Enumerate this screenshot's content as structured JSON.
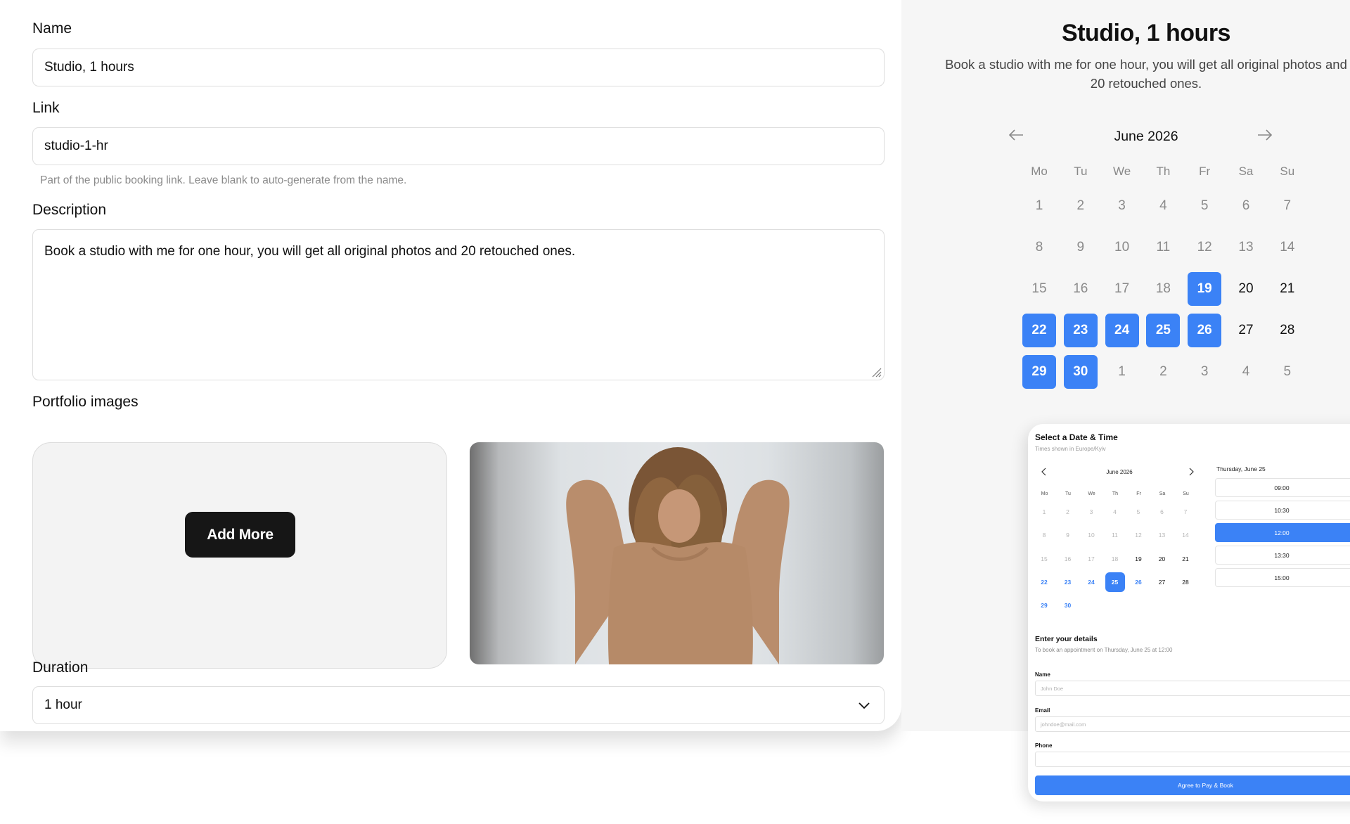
{
  "form": {
    "name_label": "Name",
    "name_value": "Studio, 1 hours",
    "link_label": "Link",
    "link_value": "studio-1-hr",
    "link_hint": "Part of the public booking link. Leave blank to auto-generate from the name.",
    "description_label": "Description",
    "description_value": "Book a studio with me for one hour, you will get all original photos and 20 retouched ones.",
    "portfolio_label": "Portfolio images",
    "add_more_label": "Add More",
    "duration_label": "Duration",
    "duration_value": "1 hour"
  },
  "preview": {
    "title": "Studio, 1 hours",
    "description": "Book a studio with me for one hour, you will get all original photos and 20 retouched ones.",
    "month": "June 2026",
    "weekdays": [
      "Mo",
      "Tu",
      "We",
      "Th",
      "Fr",
      "Sa",
      "Su"
    ],
    "weeks": [
      [
        {
          "d": "1",
          "s": "muted"
        },
        {
          "d": "2",
          "s": "muted"
        },
        {
          "d": "3",
          "s": "muted"
        },
        {
          "d": "4",
          "s": "muted"
        },
        {
          "d": "5",
          "s": "muted"
        },
        {
          "d": "6",
          "s": "muted"
        },
        {
          "d": "7",
          "s": "muted"
        }
      ],
      [
        {
          "d": "8",
          "s": "muted"
        },
        {
          "d": "9",
          "s": "muted"
        },
        {
          "d": "10",
          "s": "muted"
        },
        {
          "d": "11",
          "s": "muted"
        },
        {
          "d": "12",
          "s": "muted"
        },
        {
          "d": "13",
          "s": "muted"
        },
        {
          "d": "14",
          "s": "muted"
        }
      ],
      [
        {
          "d": "15",
          "s": "muted"
        },
        {
          "d": "16",
          "s": "muted"
        },
        {
          "d": "17",
          "s": "muted"
        },
        {
          "d": "18",
          "s": "muted"
        },
        {
          "d": "19",
          "s": "sel"
        },
        {
          "d": "20",
          "s": "avail"
        },
        {
          "d": "21",
          "s": "avail"
        }
      ],
      [
        {
          "d": "22",
          "s": "sel"
        },
        {
          "d": "23",
          "s": "sel"
        },
        {
          "d": "24",
          "s": "sel"
        },
        {
          "d": "25",
          "s": "sel"
        },
        {
          "d": "26",
          "s": "sel"
        },
        {
          "d": "27",
          "s": "avail"
        },
        {
          "d": "28",
          "s": "avail"
        }
      ],
      [
        {
          "d": "29",
          "s": "sel"
        },
        {
          "d": "30",
          "s": "sel"
        },
        {
          "d": "1",
          "s": "muted"
        },
        {
          "d": "2",
          "s": "muted"
        },
        {
          "d": "3",
          "s": "muted"
        },
        {
          "d": "4",
          "s": "muted"
        },
        {
          "d": "5",
          "s": "muted"
        }
      ]
    ]
  },
  "widget": {
    "title": "Select a Date & Time",
    "timezone_note": "Times shown in Europe/Kyiv",
    "month": "June 2026",
    "weekdays": [
      "Mo",
      "Tu",
      "We",
      "Th",
      "Fr",
      "Sa",
      "Su"
    ],
    "weeks": [
      [
        {
          "d": "1",
          "s": "muted"
        },
        {
          "d": "2",
          "s": "muted"
        },
        {
          "d": "3",
          "s": "muted"
        },
        {
          "d": "4",
          "s": "muted"
        },
        {
          "d": "5",
          "s": "muted"
        },
        {
          "d": "6",
          "s": "muted"
        },
        {
          "d": "7",
          "s": "muted"
        }
      ],
      [
        {
          "d": "8",
          "s": "muted"
        },
        {
          "d": "9",
          "s": "muted"
        },
        {
          "d": "10",
          "s": "muted"
        },
        {
          "d": "11",
          "s": "muted"
        },
        {
          "d": "12",
          "s": "muted"
        },
        {
          "d": "13",
          "s": "muted"
        },
        {
          "d": "14",
          "s": "muted"
        }
      ],
      [
        {
          "d": "15",
          "s": "muted"
        },
        {
          "d": "16",
          "s": "muted"
        },
        {
          "d": "17",
          "s": "muted"
        },
        {
          "d": "18",
          "s": "muted"
        },
        {
          "d": "19",
          "s": "avail"
        },
        {
          "d": "20",
          "s": "avail"
        },
        {
          "d": "21",
          "s": "avail"
        }
      ],
      [
        {
          "d": "22",
          "s": "open"
        },
        {
          "d": "23",
          "s": "open"
        },
        {
          "d": "24",
          "s": "open"
        },
        {
          "d": "25",
          "s": "sel"
        },
        {
          "d": "26",
          "s": "open"
        },
        {
          "d": "27",
          "s": "avail"
        },
        {
          "d": "28",
          "s": "avail"
        }
      ],
      [
        {
          "d": "29",
          "s": "open"
        },
        {
          "d": "30",
          "s": "open"
        }
      ]
    ],
    "selected_date_heading": "Thursday, June 25",
    "slots": [
      {
        "time": "09:00",
        "selected": false
      },
      {
        "time": "10:30",
        "selected": false
      },
      {
        "time": "12:00",
        "selected": true
      },
      {
        "time": "13:30",
        "selected": false
      },
      {
        "time": "15:00",
        "selected": false
      }
    ],
    "details_title": "Enter your details",
    "details_note": "To book an appointment on Thursday, June 25 at 12:00",
    "name_label": "Name",
    "name_placeholder": "John Doe",
    "email_label": "Email",
    "email_placeholder": "johndoe@mail.com",
    "phone_label": "Phone",
    "phone_placeholder": "",
    "submit_label": "Agree to Pay & Book"
  },
  "colors": {
    "accent": "#3b82f6",
    "button_dark": "#161616"
  }
}
